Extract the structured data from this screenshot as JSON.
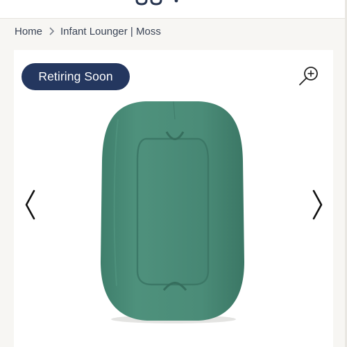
{
  "breadcrumb": {
    "home": "Home",
    "current": "Infant Lounger | Moss"
  },
  "gallery": {
    "badge": "Retiring Soon",
    "product_color": "#4e8f7b",
    "badge_color": "#24375f"
  },
  "icons": {
    "zoom": "zoom-in-icon",
    "prev": "chevron-left-icon",
    "next": "chevron-right-icon",
    "separator": "chevron-right-icon"
  }
}
